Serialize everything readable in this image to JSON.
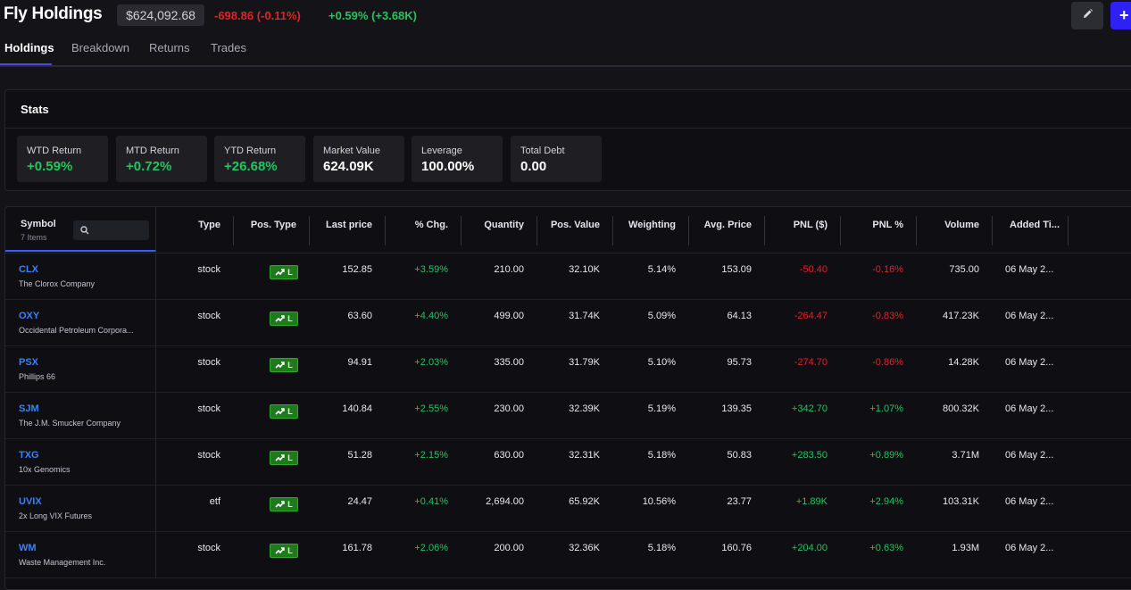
{
  "header": {
    "title": "Fly Holdings",
    "total_value": "$624,092.68",
    "day_change": "-698.86 (-0.11%)",
    "ytd_change": "+0.59% (+3.68K)",
    "edit_icon": "pencil-icon",
    "add_label": "+"
  },
  "tabs": [
    {
      "label": "Holdings",
      "active": true
    },
    {
      "label": "Breakdown",
      "active": false
    },
    {
      "label": "Returns",
      "active": false
    },
    {
      "label": "Trades",
      "active": false
    }
  ],
  "stats": {
    "title": "Stats",
    "items": [
      {
        "label": "WTD Return",
        "value": "+0.59%"
      },
      {
        "label": "MTD Return",
        "value": "+0.72%"
      },
      {
        "label": "YTD Return",
        "value": "+26.68%"
      },
      {
        "label": "Market Value",
        "value": "624.09K"
      },
      {
        "label": "Leverage",
        "value": "100.00%"
      },
      {
        "label": "Total Debt",
        "value": "0.00"
      }
    ]
  },
  "table": {
    "symbol_header": "Symbol",
    "item_count": "7 Items",
    "columns": [
      "Type",
      "Pos. Type",
      "Last price",
      "% Chg.",
      "Quantity",
      "Pos. Value",
      "Weighting",
      "Avg. Price",
      "PNL ($)",
      "PNL %",
      "Volume",
      "Added Ti..."
    ],
    "rows": [
      {
        "ticker": "CLX",
        "company": "The Clorox Company",
        "type": "stock",
        "pos_type": "L",
        "last_price": "152.85",
        "chg": "+3.59%",
        "quantity": "210.00",
        "pos_value": "32.10K",
        "weighting": "5.14%",
        "avg_price": "153.09",
        "pnl": "-50.40",
        "pnl_pct": "-0.16%",
        "volume": "735.00",
        "added": "06 May 2..."
      },
      {
        "ticker": "OXY",
        "company": "Occidental Petroleum Corpora...",
        "type": "stock",
        "pos_type": "L",
        "last_price": "63.60",
        "chg": "+4.40%",
        "quantity": "499.00",
        "pos_value": "31.74K",
        "weighting": "5.09%",
        "avg_price": "64.13",
        "pnl": "-264.47",
        "pnl_pct": "-0.83%",
        "volume": "417.23K",
        "added": "06 May 2..."
      },
      {
        "ticker": "PSX",
        "company": "Phillips 66",
        "type": "stock",
        "pos_type": "L",
        "last_price": "94.91",
        "chg": "+2.03%",
        "quantity": "335.00",
        "pos_value": "31.79K",
        "weighting": "5.10%",
        "avg_price": "95.73",
        "pnl": "-274.70",
        "pnl_pct": "-0.86%",
        "volume": "14.28K",
        "added": "06 May 2..."
      },
      {
        "ticker": "SJM",
        "company": "The J.M. Smucker Company",
        "type": "stock",
        "pos_type": "L",
        "last_price": "140.84",
        "chg": "+2.55%",
        "quantity": "230.00",
        "pos_value": "32.39K",
        "weighting": "5.19%",
        "avg_price": "139.35",
        "pnl": "+342.70",
        "pnl_pct": "+1.07%",
        "volume": "800.32K",
        "added": "06 May 2..."
      },
      {
        "ticker": "TXG",
        "company": "10x Genomics",
        "type": "stock",
        "pos_type": "L",
        "last_price": "51.28",
        "chg": "+2.15%",
        "quantity": "630.00",
        "pos_value": "32.31K",
        "weighting": "5.18%",
        "avg_price": "50.83",
        "pnl": "+283.50",
        "pnl_pct": "+0.89%",
        "volume": "3.71M",
        "added": "06 May 2..."
      },
      {
        "ticker": "UVIX",
        "company": "2x Long VIX Futures",
        "type": "etf",
        "pos_type": "L",
        "last_price": "24.47",
        "chg": "+0.41%",
        "quantity": "2,694.00",
        "pos_value": "65.92K",
        "weighting": "10.56%",
        "avg_price": "23.77",
        "pnl": "+1.89K",
        "pnl_pct": "+2.94%",
        "volume": "103.31K",
        "added": "06 May 2..."
      },
      {
        "ticker": "WM",
        "company": "Waste Management Inc.",
        "type": "stock",
        "pos_type": "L",
        "last_price": "161.78",
        "chg": "+2.06%",
        "quantity": "200.00",
        "pos_value": "32.36K",
        "weighting": "5.18%",
        "avg_price": "160.76",
        "pnl": "+204.00",
        "pnl_pct": "+0.63%",
        "volume": "1.93M",
        "added": "06 May 2..."
      }
    ]
  },
  "colors": {
    "positive": "#22c55e",
    "negative": "#e02424",
    "ticker": "#3b82f6",
    "accent": "#2f21f5"
  }
}
